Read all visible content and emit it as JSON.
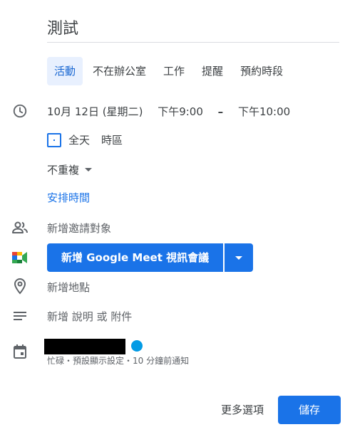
{
  "event": {
    "title": "測試"
  },
  "tabs": [
    {
      "label": "活動",
      "active": true
    },
    {
      "label": "不在辦公室",
      "active": false
    },
    {
      "label": "工作",
      "active": false
    },
    {
      "label": "提醒",
      "active": false
    },
    {
      "label": "預約時段",
      "active": false
    }
  ],
  "datetime": {
    "date": "10月 12日 (星期二)",
    "start": "下午9:00",
    "separator": "–",
    "end": "下午10:00"
  },
  "allday": {
    "label": "全天",
    "timezone_label": "時區",
    "checked": false
  },
  "repeat": {
    "label": "不重複"
  },
  "schedule": {
    "link_label": "安排時間"
  },
  "guests": {
    "placeholder": "新增邀請對象"
  },
  "meet": {
    "button_label": "新增 Google Meet 視訊會議"
  },
  "location": {
    "placeholder": "新增地點"
  },
  "description": {
    "placeholder": "新增 說明 或 附件"
  },
  "calendar": {
    "color": "#039be5",
    "info": "忙碌・預設顯示設定・10 分鐘前通知"
  },
  "footer": {
    "more_options_label": "更多選項",
    "save_label": "儲存"
  },
  "colors": {
    "accent": "#1a73e8",
    "tab_active_bg": "#e8f0fe"
  }
}
